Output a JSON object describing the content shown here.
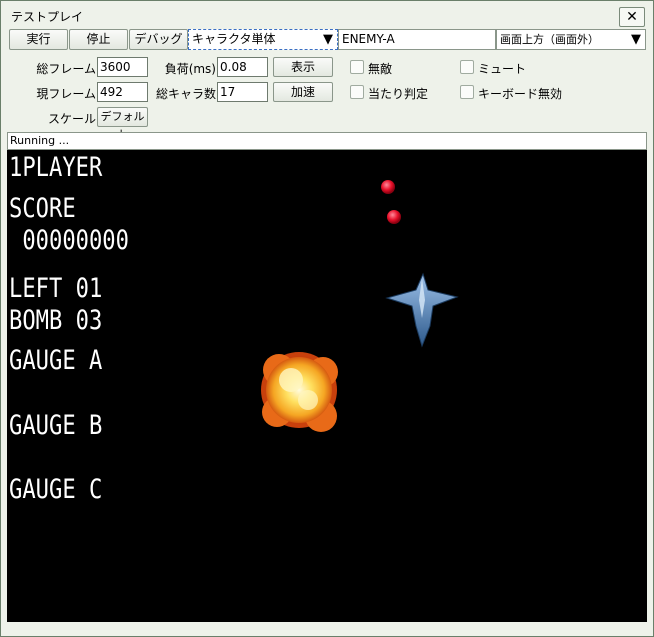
{
  "window": {
    "title": "テストプレイ",
    "close_glyph": "✕"
  },
  "toolbar": {
    "run_label": "実行",
    "stop_label": "停止",
    "debug_label": "デバッグ",
    "mode_select": "キャラクタ単体",
    "enemy_select": "ENEMY-A",
    "position_select": "画面上方（画面外）",
    "dropdown_glyph": "▼"
  },
  "stats": {
    "total_frames_label": "総フレーム",
    "total_frames_value": "3600",
    "current_frame_label": "現フレーム",
    "current_frame_value": "492",
    "scale_label": "スケール",
    "scale_button": "デフォルト",
    "load_label": "負荷(ms)",
    "load_value": "0.08",
    "total_chars_label": "総キャラ数",
    "total_chars_value": "17",
    "show_button": "表示",
    "speedup_button": "加速"
  },
  "options": [
    {
      "label": "無敵",
      "checked": false
    },
    {
      "label": "当たり判定",
      "checked": false
    },
    {
      "label": "ミュート",
      "checked": false
    },
    {
      "label": "キーボード無効",
      "checked": false
    }
  ],
  "status": {
    "text": "Running ..."
  },
  "hud": {
    "player": "1PLAYER",
    "score_label": "SCORE",
    "score_value": " 00000000",
    "left": "LEFT 01",
    "bomb": "BOMB 03",
    "gauge_a": "GAUGE A",
    "gauge_b": "GAUGE B",
    "gauge_c": "GAUGE C"
  },
  "colors": {
    "window_bg": "#eef2ea",
    "game_bg": "#000000",
    "hud_text": "#ffffff",
    "bullet": "#e8102a",
    "ship": "#5a86b8",
    "explosion": "#f5a623"
  }
}
